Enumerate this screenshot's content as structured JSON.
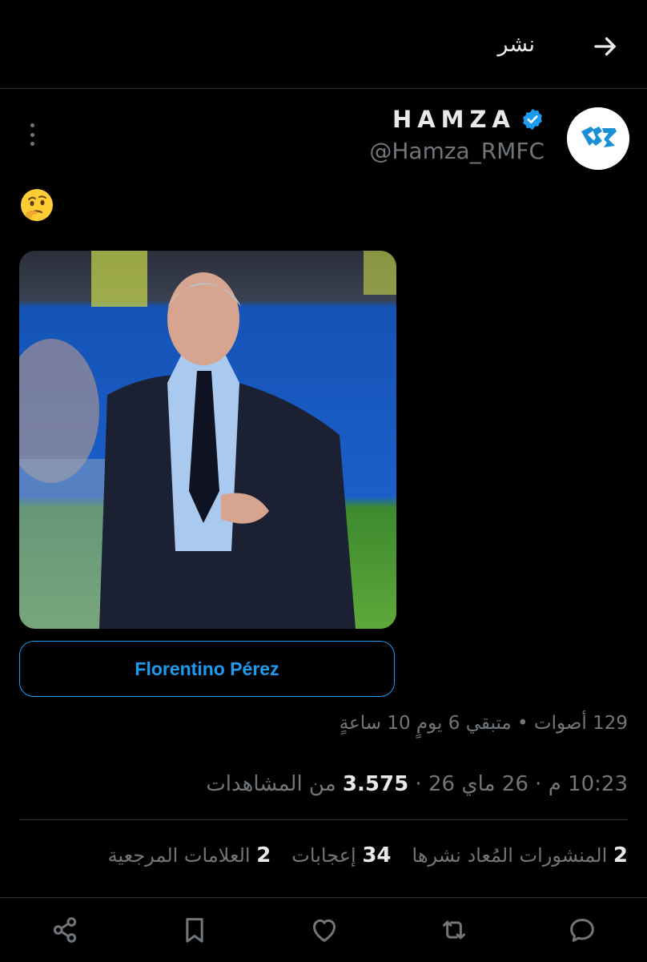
{
  "header": {
    "title": "نشر"
  },
  "author": {
    "name": "HAMZA",
    "handle": "@Hamza_RMFC"
  },
  "post": {
    "emoji": "🤔"
  },
  "poll": {
    "option_label": "Florentino Pérez",
    "meta": "129 أصوات • متبقي 6 يومٍ 10 ساعةٍ"
  },
  "timestamp": {
    "time": "10:23 م",
    "date": "26 ماي 26",
    "views_count": "3.575",
    "views_label": "من المشاهدات"
  },
  "stats": {
    "reposts_count": "2",
    "reposts_label": "المنشورات المُعاد نشرها",
    "likes_count": "34",
    "likes_label": "إعجابات",
    "bookmarks_count": "2",
    "bookmarks_label": "العلامات المرجعية"
  },
  "colors": {
    "accent": "#1d9bf0",
    "secondary_text": "#71767b",
    "background": "#000000"
  },
  "icons": [
    "arrow-right-icon",
    "more-vertical-icon",
    "verified-badge-icon",
    "reply-icon",
    "repost-icon",
    "like-icon",
    "bookmark-icon",
    "share-icon"
  ]
}
